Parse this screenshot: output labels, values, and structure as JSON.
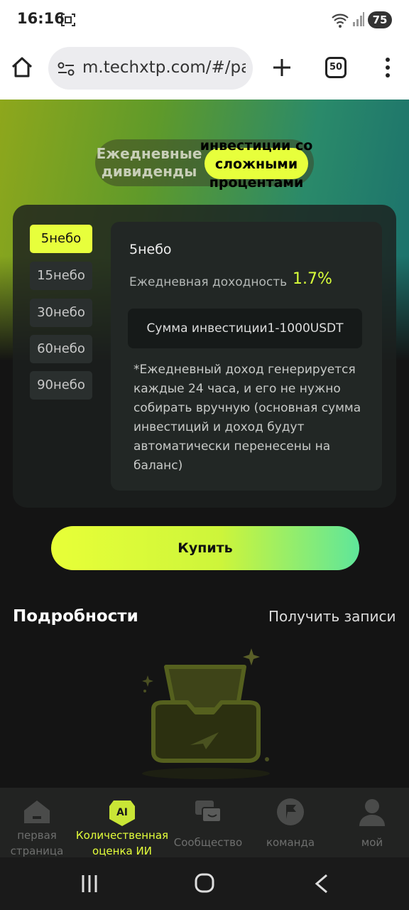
{
  "status_bar": {
    "time": "16:16",
    "battery": "75"
  },
  "browser": {
    "url": "m.techxtp.com/#/pa",
    "tab_count": "50"
  },
  "toggle": {
    "left_label": "Ежедневные дивиденды",
    "right_label": "инвестиции со сложными процентами"
  },
  "plans": {
    "tabs": [
      {
        "label": "5небо",
        "active": true
      },
      {
        "label": "15небо",
        "active": false
      },
      {
        "label": "30небо",
        "active": false
      },
      {
        "label": "60небо",
        "active": false
      },
      {
        "label": "90небо",
        "active": false
      }
    ],
    "selected_title": "5небо",
    "yield_label": "Ежедневная доходность",
    "yield_value": "1.7%",
    "amount": "Сумма инвестиции1-1000USDT",
    "note": "*Ежедневный доход генерируется каждые 24 часа, и его не нужно собирать вручную (основная сумма инвестиций и доход будут автоматически перенесены на баланс)"
  },
  "buy_label": "Купить",
  "details": {
    "title": "Подробности",
    "records_link": "Получить записи"
  },
  "bottom_nav": [
    {
      "label": "первая страница",
      "icon": "home-icon",
      "active": false
    },
    {
      "label": "Количественная оценка ИИ",
      "icon": "ai-icon",
      "active": true
    },
    {
      "label": "Сообщество",
      "icon": "chat-icon",
      "active": false
    },
    {
      "label": "команда",
      "icon": "flag-icon",
      "active": false
    },
    {
      "label": "мой",
      "icon": "profile-icon",
      "active": false
    }
  ],
  "colors": {
    "accent": "#e7ff3c",
    "background": "#141414"
  }
}
